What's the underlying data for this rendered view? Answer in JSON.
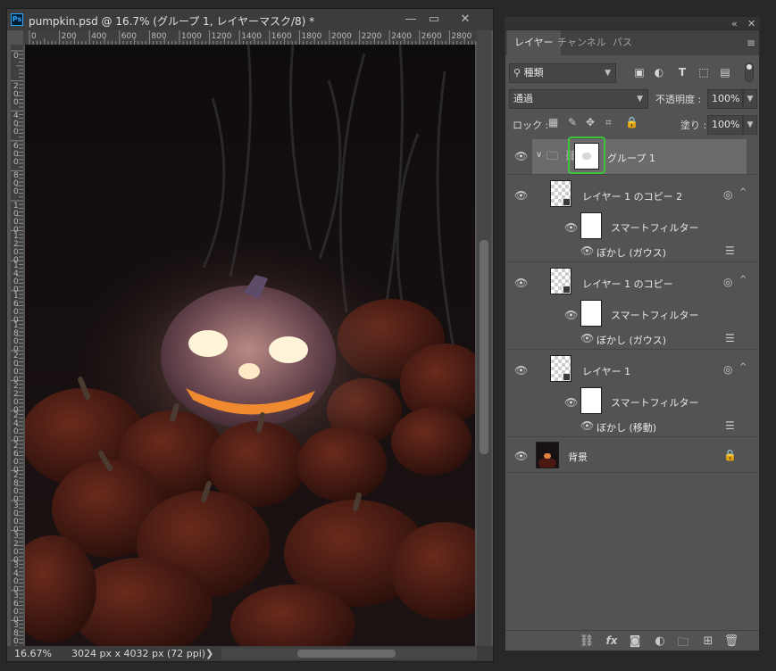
{
  "document": {
    "title": "pumpkin.psd @ 16.7% (グループ 1, レイヤーマスク/8) *",
    "app_icon": "Ps",
    "window_buttons": {
      "minimize": "—",
      "restore": "▭",
      "close": "✕"
    },
    "ruler_top_ticks": [
      "0",
      "200",
      "400",
      "600",
      "800",
      "1000",
      "1200",
      "1400",
      "1600",
      "1800",
      "2000",
      "2200",
      "2400",
      "2600",
      "2800"
    ],
    "ruler_left_ticks": [
      "0",
      "2\n0\n0",
      "4\n0\n0",
      "6\n0\n0",
      "8\n0\n0",
      "1\n0\n0\n0",
      "1\n2\n0\n0",
      "1\n4\n0\n0",
      "1\n6\n0\n0",
      "1\n8\n0\n0",
      "2\n0\n0\n0",
      "2\n2\n0\n0",
      "2\n4\n0\n0",
      "2\n6\n0\n0",
      "2\n8\n0\n0",
      "3\n0\n0\n0",
      "3\n2\n0\n0",
      "3\n4\n0\n0",
      "3\n6\n0\n0",
      "3\n8\n0\n0",
      "4\n0\n0\n0"
    ],
    "status": {
      "zoom": "16.67%",
      "size": "3024 px x 4032 px (72 ppi)",
      "arrow": "❯"
    }
  },
  "layers_panel": {
    "collapse_icon": "«",
    "close_icon": "✕",
    "tabs": [
      {
        "label": "レイヤー",
        "active": true
      },
      {
        "label": "チャンネル",
        "active": false
      },
      {
        "label": "パス",
        "active": false
      }
    ],
    "menu_icon": "≡",
    "filter": {
      "icon": "search-icon",
      "value": "種類"
    },
    "blend_mode": "通過",
    "opacity": {
      "label": "不透明度 :",
      "value": "100%"
    },
    "lock": {
      "label": "ロック :"
    },
    "fill": {
      "label": "塗り :",
      "value": "100%"
    },
    "layers": [
      {
        "name": "グループ 1",
        "type": "group",
        "selected": true
      },
      {
        "name": "レイヤー 1 のコピー 2",
        "type": "smart"
      },
      {
        "name": "スマートフィルター",
        "type": "filter-mask"
      },
      {
        "name": "ぼかし (ガウス)",
        "type": "filter"
      },
      {
        "name": "レイヤー 1 のコピー",
        "type": "smart"
      },
      {
        "name": "スマートフィルター",
        "type": "filter-mask"
      },
      {
        "name": "ぼかし (ガウス)",
        "type": "filter"
      },
      {
        "name": "レイヤー 1",
        "type": "smart"
      },
      {
        "name": "スマートフィルター",
        "type": "filter-mask"
      },
      {
        "name": "ぼかし (移動)",
        "type": "filter"
      },
      {
        "name": "背景",
        "type": "background",
        "locked": true
      }
    ],
    "bottom_icons": [
      "link-icon",
      "fx-icon",
      "mask-icon",
      "adjustment-icon",
      "folder-icon",
      "new-layer-icon",
      "trash-icon"
    ]
  },
  "colors": {
    "highlight": "#3cc63c",
    "ui_bg": "#535353",
    "selected_row": "#6b6b6b"
  }
}
